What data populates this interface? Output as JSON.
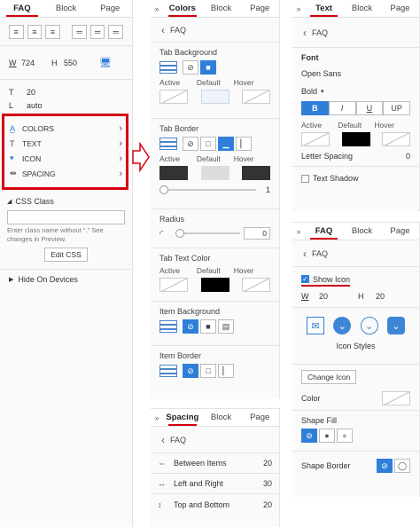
{
  "tabs": {
    "faq": "FAQ",
    "block": "Block",
    "page": "Page",
    "colors": "Colors",
    "text": "Text",
    "spacing": "Spacing"
  },
  "back_label": "FAQ",
  "panel1": {
    "width_label": "W",
    "width": "724",
    "height_label": "H",
    "height": "550",
    "t_label": "T",
    "t_value": "20",
    "l_label": "L",
    "l_value": "auto",
    "menu": [
      "COLORS",
      "TEXT",
      "ICON",
      "SPACING"
    ],
    "css_class": "CSS Class",
    "css_note": "Enter class name without \".\" See changes in Preview.",
    "edit_css": "Edit CSS",
    "hide": "Hide On Devices"
  },
  "colors_panel": {
    "tab_bg": "Tab Background",
    "tab_border": "Tab Border",
    "active": "Active",
    "default": "Default",
    "hover": "Hover",
    "border_value": "1",
    "radius": "Radius",
    "radius_value": "0",
    "tab_text_color": "Tab Text Color",
    "item_bg": "Item Background",
    "item_border": "Item Border"
  },
  "text_panel": {
    "font": "Font",
    "font_name": "Open Sans",
    "weight": "Bold",
    "styles": [
      "B",
      "I",
      "U",
      "UP"
    ],
    "active": "Active",
    "default": "Default",
    "hover": "Hover",
    "letter_spacing": "Letter Spacing",
    "letter_spacing_value": "0",
    "text_shadow": "Text Shadow"
  },
  "icon_panel": {
    "show_icon": "Show Icon",
    "w_label": "W",
    "w_value": "20",
    "h_label": "H",
    "h_value": "20",
    "icon_styles": "Icon Styles",
    "change_icon": "Change Icon",
    "color": "Color",
    "shape_fill": "Shape Fill",
    "shape_border": "Shape Border"
  },
  "spacing_panel": {
    "rows": [
      {
        "label": "Between Items",
        "value": "20"
      },
      {
        "label": "Left and Right",
        "value": "30"
      },
      {
        "label": "Top and Bottom",
        "value": "20"
      }
    ]
  },
  "colors": {
    "accent": "#d5000f",
    "blue": "#2f7fd9"
  }
}
